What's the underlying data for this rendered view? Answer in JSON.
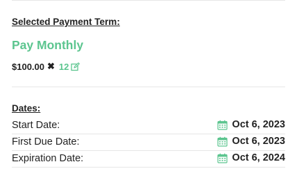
{
  "payment_term": {
    "heading": "Selected Payment Term:",
    "title": "Pay Monthly",
    "amount": "$100.00",
    "times_symbol": "✖",
    "count": "12",
    "edit_icon": "edit-icon"
  },
  "dates": {
    "heading": "Dates:",
    "calendar_icon": "calendar-icon",
    "rows": [
      {
        "label": "Start Date:",
        "value": "Oct 6, 2023"
      },
      {
        "label": "First Due Date:",
        "value": "Oct 6, 2023"
      },
      {
        "label": "Expiration Date:",
        "value": "Oct 6, 2024"
      }
    ]
  },
  "colors": {
    "accent": "#5cc58f",
    "text": "#222222",
    "divider": "#e6e6e6"
  }
}
